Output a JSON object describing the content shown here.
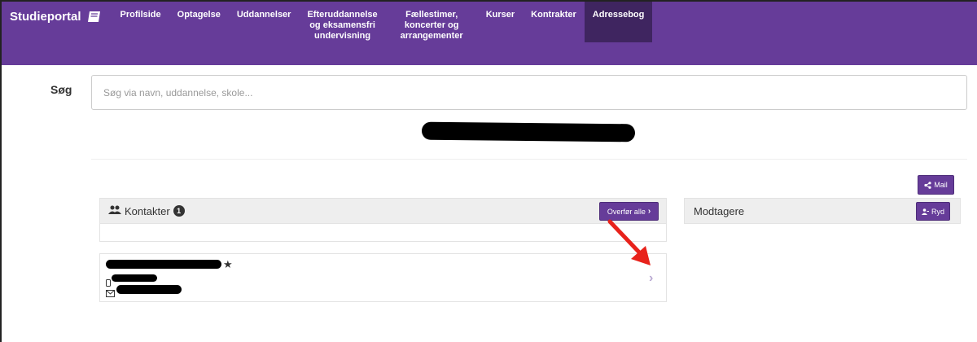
{
  "nav": {
    "brand": "Studieportal",
    "brand_icon": "book-icon",
    "items": [
      {
        "lines": [
          "Profilside"
        ]
      },
      {
        "lines": [
          "Optagelse"
        ]
      },
      {
        "lines": [
          "Uddannelser"
        ]
      },
      {
        "lines": [
          "Efteruddannelse",
          "og eksamensfri",
          "undervisning"
        ]
      },
      {
        "lines": [
          "Fællestimer,",
          "koncerter og",
          "arrangementer"
        ]
      },
      {
        "lines": [
          "Kurser"
        ]
      },
      {
        "lines": [
          "Kontrakter"
        ]
      },
      {
        "lines": [
          "Adressebog"
        ]
      }
    ],
    "active": "Adressebog",
    "color": "#663c99",
    "active_color": "#3f2560"
  },
  "search": {
    "label": "Søg",
    "placeholder": "Søg via navn, uddannelse, skole..."
  },
  "buttons": {
    "mail": "Mail",
    "transfer_all": "Overfør alle",
    "clear": "Ryd"
  },
  "contacts": {
    "title": "Kontakter",
    "count": "1",
    "items": [
      {
        "starred": true,
        "has_phone": true,
        "has_email": true
      }
    ]
  },
  "recipients": {
    "title": "Modtagere"
  },
  "annotation": {
    "arrow_color": "#e8221b"
  }
}
